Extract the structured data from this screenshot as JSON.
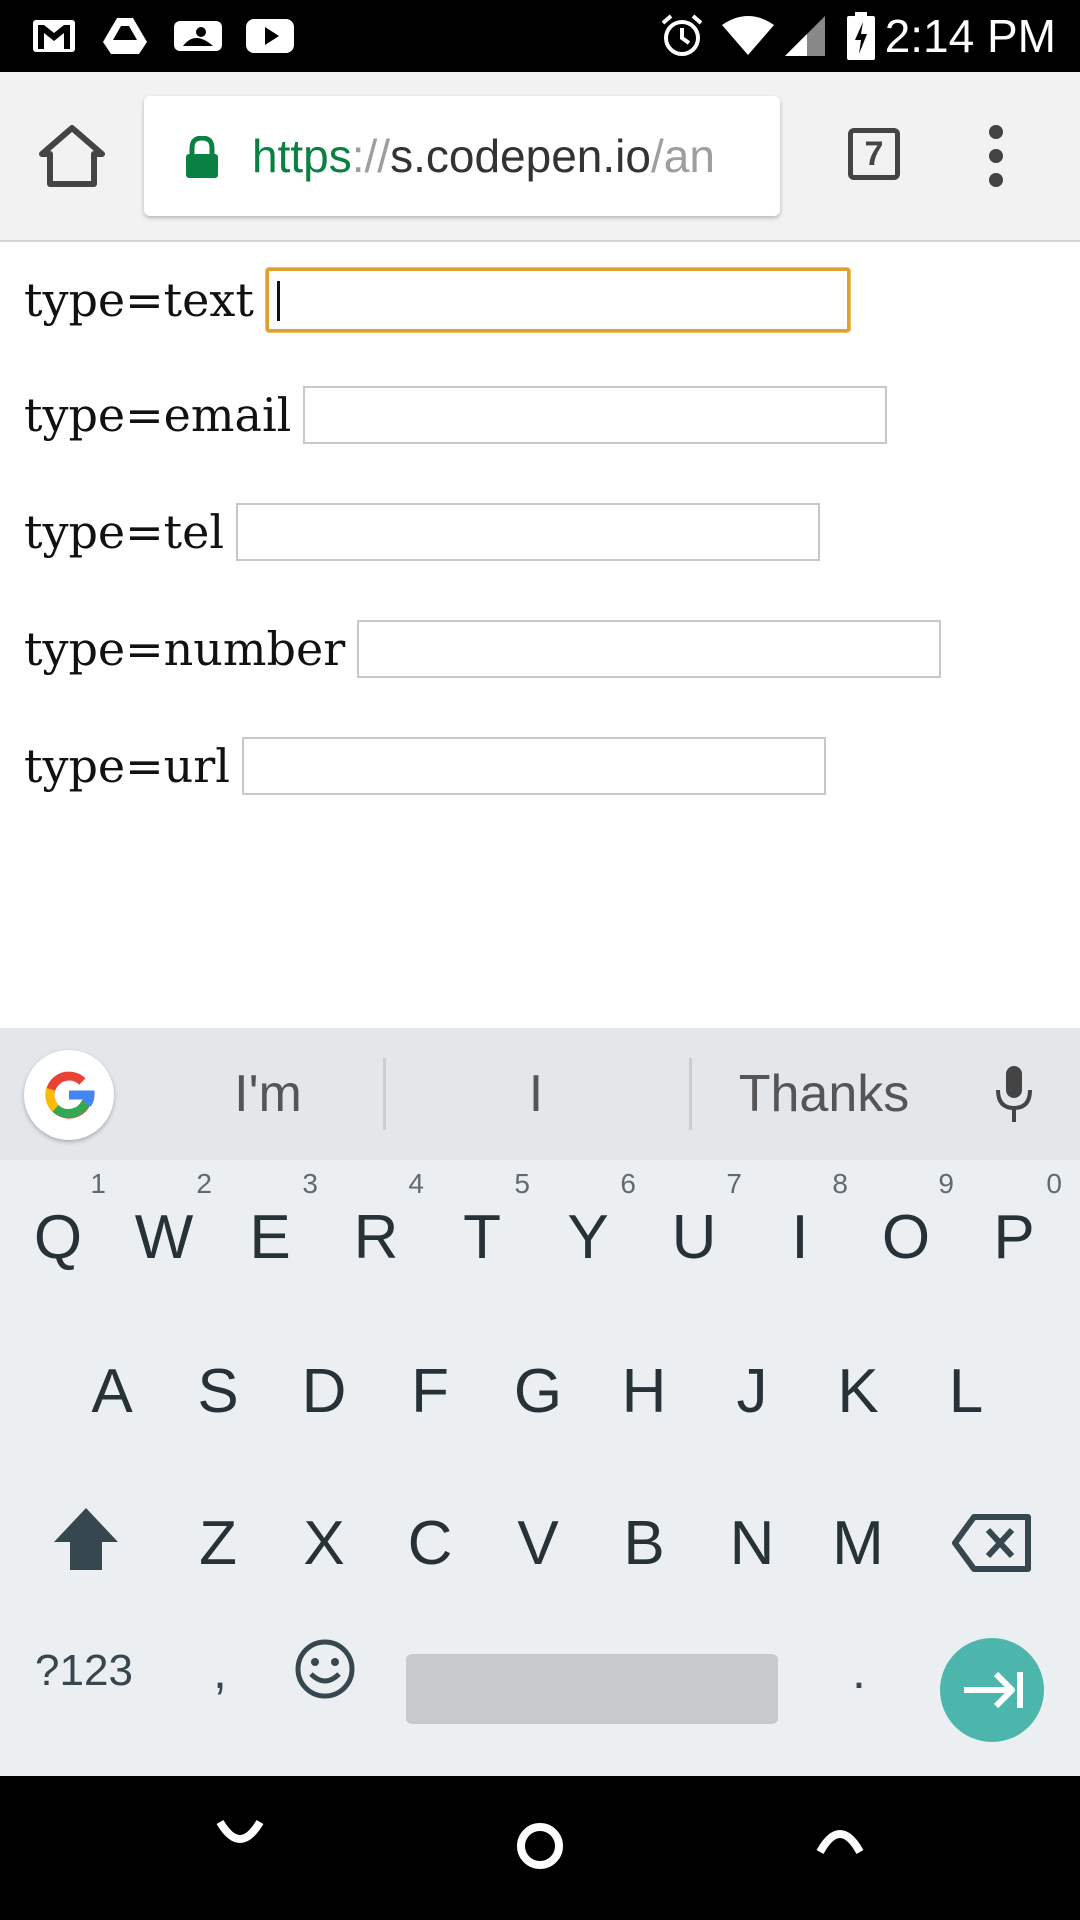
{
  "status_bar": {
    "time": "2:14 PM",
    "left_icons": [
      "gmail-icon",
      "drive-icon",
      "mlb-icon",
      "youtube-icon"
    ],
    "right_icons": [
      "alarm-icon",
      "wifi-icon",
      "signal-icon",
      "battery-charging-icon"
    ]
  },
  "browser": {
    "url_scheme": "https",
    "url_separator": "://",
    "url_host": "s.codepen.io",
    "url_path": "/an",
    "tab_count": "7",
    "colors": {
      "secure_green": "#0b8043"
    }
  },
  "form": {
    "rows": [
      {
        "label": "type=text",
        "value": "",
        "focused": true
      },
      {
        "label": "type=email",
        "value": ""
      },
      {
        "label": "type=tel",
        "value": ""
      },
      {
        "label": "type=number",
        "value": ""
      },
      {
        "label": "type=url",
        "value": ""
      }
    ]
  },
  "keyboard": {
    "suggestions": [
      "I'm",
      "I",
      "Thanks"
    ],
    "row1": [
      {
        "key": "Q",
        "hint": "1"
      },
      {
        "key": "W",
        "hint": "2"
      },
      {
        "key": "E",
        "hint": "3"
      },
      {
        "key": "R",
        "hint": "4"
      },
      {
        "key": "T",
        "hint": "5"
      },
      {
        "key": "Y",
        "hint": "6"
      },
      {
        "key": "U",
        "hint": "7"
      },
      {
        "key": "I",
        "hint": "8"
      },
      {
        "key": "O",
        "hint": "9"
      },
      {
        "key": "P",
        "hint": "0"
      }
    ],
    "row2": [
      "A",
      "S",
      "D",
      "F",
      "G",
      "H",
      "J",
      "K",
      "L"
    ],
    "row3": [
      "Z",
      "X",
      "C",
      "V",
      "B",
      "N",
      "M"
    ],
    "symbols_label": "?123",
    "comma_label": ",",
    "period_label": ".",
    "colors": {
      "enter_key": "#4db6ac"
    }
  }
}
